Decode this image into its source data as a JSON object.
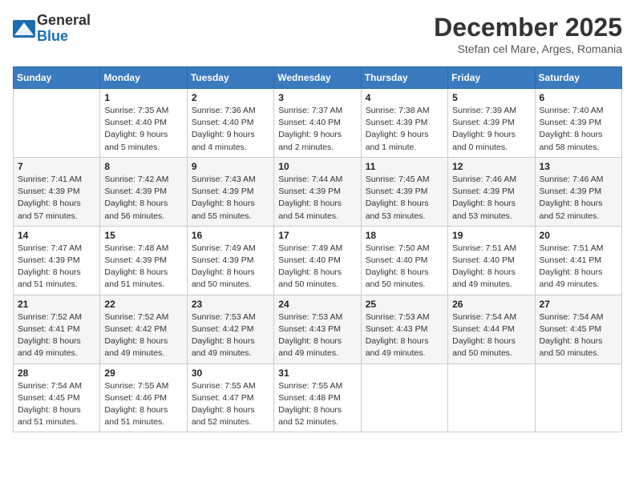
{
  "header": {
    "logo_line1": "General",
    "logo_line2": "Blue",
    "month_title": "December 2025",
    "location": "Stefan cel Mare, Arges, Romania"
  },
  "weekdays": [
    "Sunday",
    "Monday",
    "Tuesday",
    "Wednesday",
    "Thursday",
    "Friday",
    "Saturday"
  ],
  "weeks": [
    [
      {
        "day": "",
        "info": ""
      },
      {
        "day": "1",
        "info": "Sunrise: 7:35 AM\nSunset: 4:40 PM\nDaylight: 9 hours\nand 5 minutes."
      },
      {
        "day": "2",
        "info": "Sunrise: 7:36 AM\nSunset: 4:40 PM\nDaylight: 9 hours\nand 4 minutes."
      },
      {
        "day": "3",
        "info": "Sunrise: 7:37 AM\nSunset: 4:40 PM\nDaylight: 9 hours\nand 2 minutes."
      },
      {
        "day": "4",
        "info": "Sunrise: 7:38 AM\nSunset: 4:39 PM\nDaylight: 9 hours\nand 1 minute."
      },
      {
        "day": "5",
        "info": "Sunrise: 7:39 AM\nSunset: 4:39 PM\nDaylight: 9 hours\nand 0 minutes."
      },
      {
        "day": "6",
        "info": "Sunrise: 7:40 AM\nSunset: 4:39 PM\nDaylight: 8 hours\nand 58 minutes."
      }
    ],
    [
      {
        "day": "7",
        "info": "Sunrise: 7:41 AM\nSunset: 4:39 PM\nDaylight: 8 hours\nand 57 minutes."
      },
      {
        "day": "8",
        "info": "Sunrise: 7:42 AM\nSunset: 4:39 PM\nDaylight: 8 hours\nand 56 minutes."
      },
      {
        "day": "9",
        "info": "Sunrise: 7:43 AM\nSunset: 4:39 PM\nDaylight: 8 hours\nand 55 minutes."
      },
      {
        "day": "10",
        "info": "Sunrise: 7:44 AM\nSunset: 4:39 PM\nDaylight: 8 hours\nand 54 minutes."
      },
      {
        "day": "11",
        "info": "Sunrise: 7:45 AM\nSunset: 4:39 PM\nDaylight: 8 hours\nand 53 minutes."
      },
      {
        "day": "12",
        "info": "Sunrise: 7:46 AM\nSunset: 4:39 PM\nDaylight: 8 hours\nand 53 minutes."
      },
      {
        "day": "13",
        "info": "Sunrise: 7:46 AM\nSunset: 4:39 PM\nDaylight: 8 hours\nand 52 minutes."
      }
    ],
    [
      {
        "day": "14",
        "info": "Sunrise: 7:47 AM\nSunset: 4:39 PM\nDaylight: 8 hours\nand 51 minutes."
      },
      {
        "day": "15",
        "info": "Sunrise: 7:48 AM\nSunset: 4:39 PM\nDaylight: 8 hours\nand 51 minutes."
      },
      {
        "day": "16",
        "info": "Sunrise: 7:49 AM\nSunset: 4:39 PM\nDaylight: 8 hours\nand 50 minutes."
      },
      {
        "day": "17",
        "info": "Sunrise: 7:49 AM\nSunset: 4:40 PM\nDaylight: 8 hours\nand 50 minutes."
      },
      {
        "day": "18",
        "info": "Sunrise: 7:50 AM\nSunset: 4:40 PM\nDaylight: 8 hours\nand 50 minutes."
      },
      {
        "day": "19",
        "info": "Sunrise: 7:51 AM\nSunset: 4:40 PM\nDaylight: 8 hours\nand 49 minutes."
      },
      {
        "day": "20",
        "info": "Sunrise: 7:51 AM\nSunset: 4:41 PM\nDaylight: 8 hours\nand 49 minutes."
      }
    ],
    [
      {
        "day": "21",
        "info": "Sunrise: 7:52 AM\nSunset: 4:41 PM\nDaylight: 8 hours\nand 49 minutes."
      },
      {
        "day": "22",
        "info": "Sunrise: 7:52 AM\nSunset: 4:42 PM\nDaylight: 8 hours\nand 49 minutes."
      },
      {
        "day": "23",
        "info": "Sunrise: 7:53 AM\nSunset: 4:42 PM\nDaylight: 8 hours\nand 49 minutes."
      },
      {
        "day": "24",
        "info": "Sunrise: 7:53 AM\nSunset: 4:43 PM\nDaylight: 8 hours\nand 49 minutes."
      },
      {
        "day": "25",
        "info": "Sunrise: 7:53 AM\nSunset: 4:43 PM\nDaylight: 8 hours\nand 49 minutes."
      },
      {
        "day": "26",
        "info": "Sunrise: 7:54 AM\nSunset: 4:44 PM\nDaylight: 8 hours\nand 50 minutes."
      },
      {
        "day": "27",
        "info": "Sunrise: 7:54 AM\nSunset: 4:45 PM\nDaylight: 8 hours\nand 50 minutes."
      }
    ],
    [
      {
        "day": "28",
        "info": "Sunrise: 7:54 AM\nSunset: 4:45 PM\nDaylight: 8 hours\nand 51 minutes."
      },
      {
        "day": "29",
        "info": "Sunrise: 7:55 AM\nSunset: 4:46 PM\nDaylight: 8 hours\nand 51 minutes."
      },
      {
        "day": "30",
        "info": "Sunrise: 7:55 AM\nSunset: 4:47 PM\nDaylight: 8 hours\nand 52 minutes."
      },
      {
        "day": "31",
        "info": "Sunrise: 7:55 AM\nSunset: 4:48 PM\nDaylight: 8 hours\nand 52 minutes."
      },
      {
        "day": "",
        "info": ""
      },
      {
        "day": "",
        "info": ""
      },
      {
        "day": "",
        "info": ""
      }
    ]
  ]
}
